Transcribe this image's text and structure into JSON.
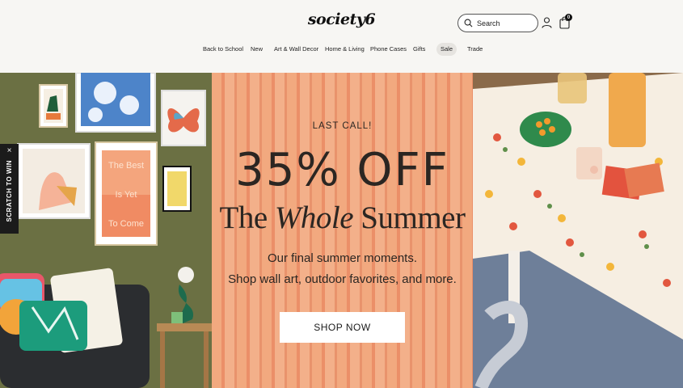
{
  "header": {
    "logo": "society6",
    "search_placeholder": "Search",
    "cart_count": "0"
  },
  "nav": {
    "items": [
      "Back to School",
      "New",
      "Art & Wall Decor",
      "Home & Living",
      "Phone Cases",
      "Gifts",
      "Sale",
      "Trade"
    ]
  },
  "hero": {
    "eyebrow": "LAST CALL!",
    "headline": "35% OFF",
    "subhead_prefix": "The ",
    "subhead_emphasis": "Whole",
    "subhead_suffix": " Summer",
    "description_line1": "Our final summer moments.",
    "description_line2": "Shop wall art, outdoor favorites, and more.",
    "cta": "SHOP NOW"
  },
  "left_art": {
    "poster_text_lines": [
      "The Best",
      "Is Yet",
      "To Come"
    ]
  },
  "scratch_tab": {
    "label": "SCRATCH TO WIN",
    "close": "×"
  },
  "colors": {
    "header_bg": "#f7f6f3",
    "wall_green": "#6b7043",
    "promo_orange": "#f2a97f",
    "text_dark": "#2b2622"
  }
}
